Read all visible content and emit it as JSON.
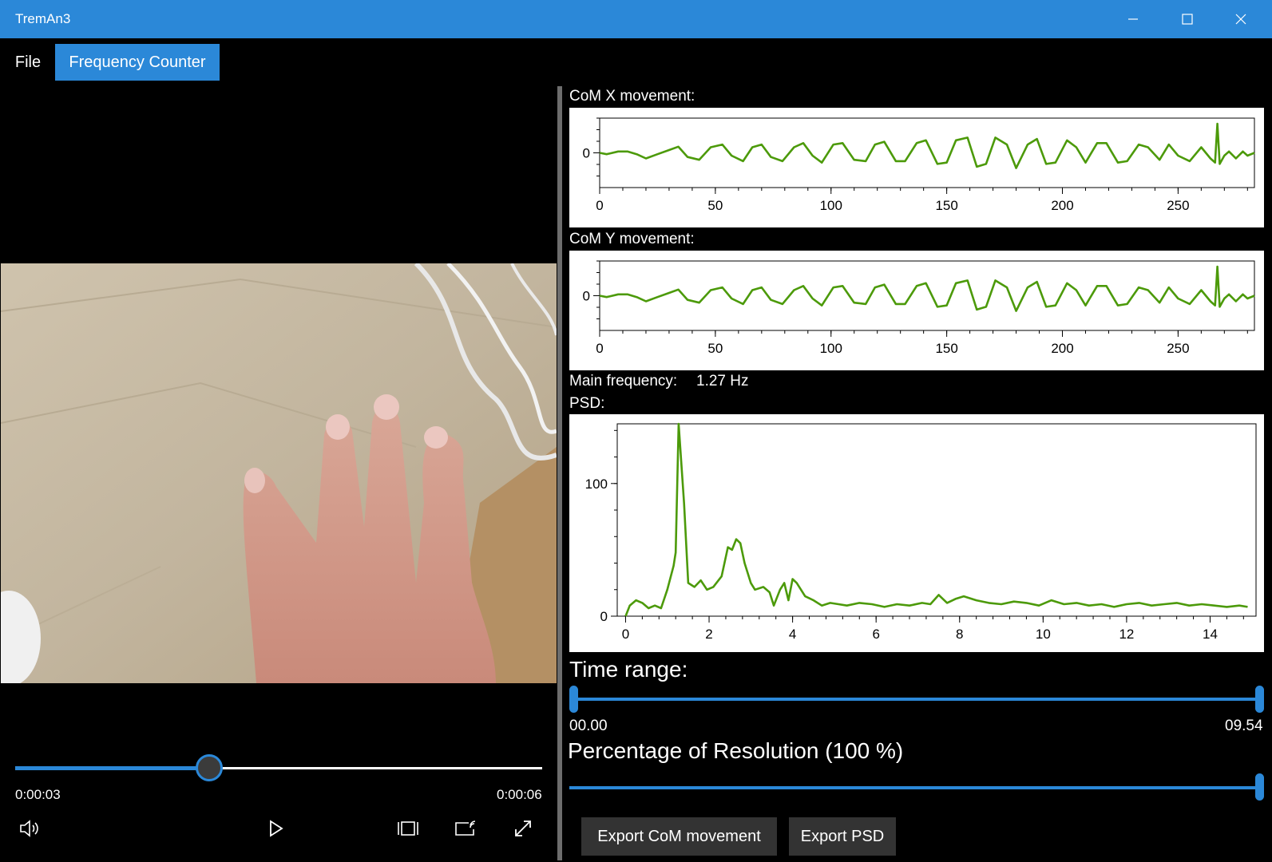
{
  "window": {
    "title": "TremAn3"
  },
  "menu": {
    "file": "File",
    "frequency_counter": "Frequency Counter"
  },
  "player": {
    "current_time": "0:00:03",
    "total_time": "0:00:06",
    "progress": 0.368,
    "controls": [
      "volume-icon",
      "play-icon",
      "aspect-ratio-icon",
      "cast-icon",
      "fullscreen-icon"
    ]
  },
  "charts": {
    "com_x_label": "CoM X movement:",
    "com_y_label": "CoM Y movement:",
    "main_frequency_label": "Main frequency:",
    "main_frequency_value": "1.27 Hz",
    "psd_label": "PSD:"
  },
  "chart_data": [
    {
      "type": "line",
      "name": "com_x",
      "xlim": [
        0,
        283
      ],
      "ylim": [
        -1.25,
        1.25
      ],
      "xticks": [
        0,
        50,
        100,
        150,
        200,
        250
      ],
      "yticks": [
        0
      ],
      "color": "#4c9a0a",
      "x": [
        0,
        3,
        8,
        12,
        16,
        20,
        25,
        30,
        34,
        38,
        43,
        48,
        53,
        57,
        62,
        66,
        70,
        74,
        79,
        84,
        88,
        92,
        96,
        101,
        105,
        110,
        115,
        119,
        123,
        128,
        132,
        137,
        141,
        146,
        150,
        154,
        159,
        163,
        167,
        171,
        176,
        180,
        185,
        189,
        193,
        197,
        202,
        206,
        210,
        215,
        219,
        224,
        228,
        233,
        237,
        242,
        246,
        250,
        255,
        260,
        264,
        266,
        267,
        268,
        270,
        272,
        275,
        278,
        280,
        283
      ],
      "y": [
        0,
        -0.05,
        0.05,
        0.05,
        -0.05,
        -0.2,
        -0.05,
        0.1,
        0.22,
        -0.15,
        -0.25,
        0.2,
        0.3,
        -0.1,
        -0.3,
        0.2,
        0.3,
        -0.15,
        -0.3,
        0.2,
        0.35,
        -0.1,
        -0.35,
        0.3,
        0.35,
        -0.25,
        -0.3,
        0.3,
        0.4,
        -0.3,
        -0.3,
        0.35,
        0.45,
        -0.4,
        -0.35,
        0.45,
        0.55,
        -0.5,
        -0.4,
        0.55,
        0.3,
        -0.55,
        0.3,
        0.5,
        -0.4,
        -0.35,
        0.45,
        0.2,
        -0.35,
        0.35,
        0.35,
        -0.35,
        -0.3,
        0.3,
        0.2,
        -0.25,
        0.3,
        -0.1,
        -0.3,
        0.2,
        -0.2,
        -0.35,
        1.05,
        -0.4,
        -0.1,
        0.05,
        -0.2,
        0.05,
        -0.1,
        0.0
      ]
    },
    {
      "type": "line",
      "name": "com_y",
      "xlim": [
        0,
        283
      ],
      "ylim": [
        -1.25,
        1.25
      ],
      "xticks": [
        0,
        50,
        100,
        150,
        200,
        250
      ],
      "yticks": [
        0
      ],
      "color": "#4c9a0a",
      "x": [
        0,
        3,
        8,
        12,
        16,
        20,
        25,
        30,
        34,
        38,
        43,
        48,
        53,
        57,
        62,
        66,
        70,
        74,
        79,
        84,
        88,
        92,
        96,
        101,
        105,
        110,
        115,
        119,
        123,
        128,
        132,
        137,
        141,
        146,
        150,
        154,
        159,
        163,
        167,
        171,
        176,
        180,
        185,
        189,
        193,
        197,
        202,
        206,
        210,
        215,
        219,
        224,
        228,
        233,
        237,
        242,
        246,
        250,
        255,
        260,
        264,
        266,
        267,
        268,
        270,
        272,
        275,
        278,
        280,
        283
      ],
      "y": [
        0,
        -0.05,
        0.05,
        0.05,
        -0.05,
        -0.2,
        -0.05,
        0.1,
        0.22,
        -0.15,
        -0.25,
        0.2,
        0.3,
        -0.1,
        -0.3,
        0.2,
        0.3,
        -0.15,
        -0.3,
        0.2,
        0.35,
        -0.1,
        -0.35,
        0.3,
        0.35,
        -0.25,
        -0.3,
        0.3,
        0.4,
        -0.3,
        -0.3,
        0.35,
        0.45,
        -0.4,
        -0.35,
        0.45,
        0.55,
        -0.5,
        -0.4,
        0.55,
        0.3,
        -0.55,
        0.3,
        0.5,
        -0.4,
        -0.35,
        0.45,
        0.2,
        -0.35,
        0.35,
        0.35,
        -0.35,
        -0.3,
        0.3,
        0.2,
        -0.25,
        0.3,
        -0.1,
        -0.3,
        0.2,
        -0.2,
        -0.35,
        1.05,
        -0.4,
        -0.1,
        0.05,
        -0.2,
        0.05,
        -0.1,
        0.0
      ]
    },
    {
      "type": "line",
      "name": "psd",
      "xlim": [
        -0.2,
        15.1
      ],
      "ylim": [
        0,
        145
      ],
      "xticks": [
        0,
        2,
        4,
        6,
        8,
        10,
        12,
        14
      ],
      "yticks": [
        0,
        100
      ],
      "color": "#4c9a0a",
      "x": [
        0,
        0.1,
        0.25,
        0.4,
        0.55,
        0.7,
        0.85,
        1.0,
        1.15,
        1.2,
        1.27,
        1.4,
        1.5,
        1.65,
        1.8,
        1.95,
        2.1,
        2.3,
        2.45,
        2.55,
        2.65,
        2.75,
        2.85,
        3.0,
        3.1,
        3.3,
        3.45,
        3.55,
        3.7,
        3.8,
        3.9,
        4.0,
        4.1,
        4.3,
        4.5,
        4.7,
        4.9,
        5.1,
        5.3,
        5.6,
        5.9,
        6.2,
        6.5,
        6.8,
        7.1,
        7.3,
        7.5,
        7.7,
        7.9,
        8.1,
        8.4,
        8.7,
        9.0,
        9.3,
        9.6,
        9.9,
        10.2,
        10.5,
        10.8,
        11.1,
        11.4,
        11.7,
        12.0,
        12.3,
        12.6,
        12.9,
        13.2,
        13.5,
        13.8,
        14.1,
        14.4,
        14.7,
        14.9
      ],
      "y": [
        0,
        8,
        12,
        10,
        6,
        8,
        6,
        20,
        38,
        48,
        145,
        85,
        25,
        22,
        27,
        20,
        22,
        30,
        52,
        50,
        58,
        55,
        40,
        25,
        20,
        22,
        18,
        8,
        20,
        25,
        12,
        28,
        25,
        15,
        12,
        8,
        10,
        9,
        8,
        10,
        9,
        7,
        9,
        8,
        10,
        9,
        16,
        10,
        13,
        15,
        12,
        10,
        9,
        11,
        10,
        8,
        12,
        9,
        10,
        8,
        9,
        7,
        9,
        10,
        8,
        9,
        10,
        8,
        9,
        8,
        7,
        8,
        7
      ]
    }
  ],
  "time_range": {
    "label": "Time range:",
    "min_value": "00.00",
    "max_value": "09.54",
    "low": 0,
    "high": 1
  },
  "resolution": {
    "label": "Percentage of Resolution (100 %)",
    "value": 1
  },
  "buttons": {
    "export_com": "Export CoM movement",
    "export_psd": "Export PSD"
  },
  "colors": {
    "accent": "#2b88d8",
    "line": "#4c9a0a",
    "background": "#000000"
  }
}
